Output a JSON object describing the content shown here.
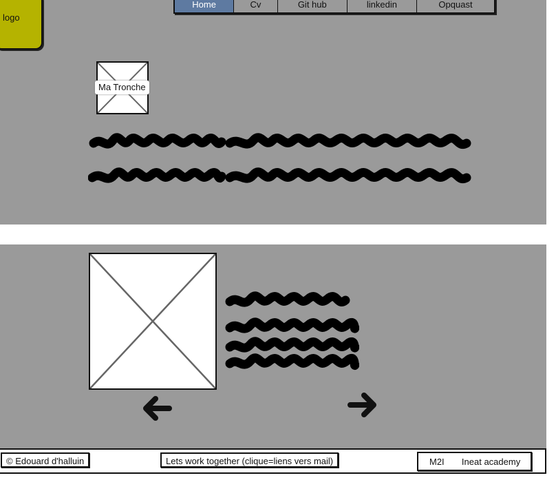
{
  "header": {
    "logo_label": "logo",
    "nav": [
      "Home",
      "Cv",
      "Git hub",
      "linkedin",
      "Opquast"
    ],
    "active_tab": "Home"
  },
  "hero": {
    "photo_caption": "Ma Tronche"
  },
  "carousel": {
    "prev_icon": "arrow-left-icon",
    "next_icon": "arrow-right-icon"
  },
  "footer": {
    "copyright": "© Edouard d'halluin",
    "contact": "Lets work together (clique=liens vers mail)",
    "school_1": "M2I",
    "school_2": "Ineat academy"
  },
  "colors": {
    "band": "#9a9a9a",
    "logo": "#b5b300",
    "nav_active": "#5e7aa1"
  }
}
